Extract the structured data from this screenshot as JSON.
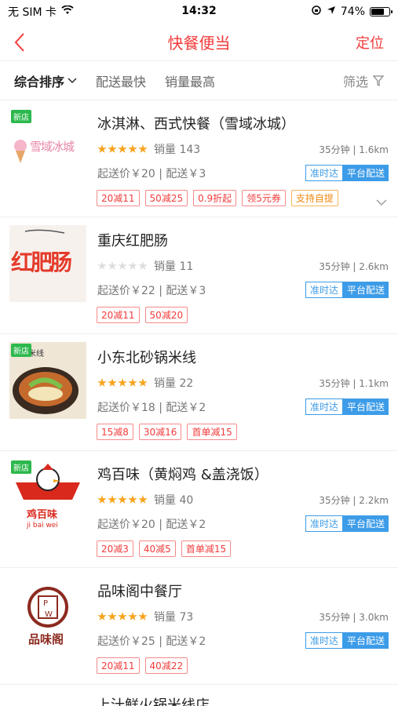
{
  "status": {
    "carrier": "无 SIM 卡",
    "time": "14:32",
    "battery": "74%",
    "battery_level": 0.74
  },
  "nav": {
    "title": "快餐便当",
    "right": "定位"
  },
  "sort": {
    "items": [
      "综合排序",
      "配送最快",
      "销量最高"
    ],
    "filter": "筛选"
  },
  "stores": [
    {
      "name": "冰淇淋、西式快餐（雪域冰城）",
      "new": "新店",
      "rating": 5,
      "sales": "销量 143",
      "dist": "35分钟 | 1.6km",
      "price": "起送价￥20 | 配送￥3",
      "ontime": "准时达",
      "platform": "平台配送",
      "promos": [
        "20减11",
        "50减25",
        "0.9折起",
        "领5元券"
      ],
      "promo_orange": "支持自提",
      "logo_text": "雪域冰城"
    },
    {
      "name": "重庆红肥肠",
      "new": "",
      "rating": 0,
      "sales": "销量 11",
      "dist": "35分钟 | 2.6km",
      "price": "起送价￥22 | 配送￥3",
      "ontime": "准时达",
      "platform": "平台配送",
      "promos": [
        "20减11",
        "50减20"
      ],
      "promo_orange": "",
      "logo_text": "红肥肠"
    },
    {
      "name": "小东北砂锅米线",
      "new": "新店",
      "rating": 5,
      "sales": "销量 22",
      "dist": "35分钟 | 1.1km",
      "price": "起送价￥18 | 配送￥2",
      "ontime": "准时达",
      "platform": "平台配送",
      "promos": [
        "15减8",
        "30减16",
        "首单减15"
      ],
      "promo_orange": "",
      "logo_text": "砂锅米线"
    },
    {
      "name": "鸡百味（黄焖鸡 &盖浇饭）",
      "new": "新店",
      "rating": 5,
      "sales": "销量 40",
      "dist": "35分钟 | 2.2km",
      "price": "起送价￥20 | 配送￥2",
      "ontime": "准时达",
      "platform": "平台配送",
      "promos": [
        "20减3",
        "40减5",
        "首单减15"
      ],
      "promo_orange": "",
      "logo_text": "鸡百味",
      "logo_sub": "ji bai wei"
    },
    {
      "name": "品味阁中餐厅",
      "new": "",
      "rating": 5,
      "sales": "销量 73",
      "dist": "35分钟 | 3.0km",
      "price": "起送价￥25 | 配送￥2",
      "ontime": "准时达",
      "platform": "平台配送",
      "promos": [
        "20减11",
        "40减22"
      ],
      "promo_orange": "",
      "logo_text": "品味阁"
    }
  ],
  "partial_store": "上汁鲜火锅米线店"
}
